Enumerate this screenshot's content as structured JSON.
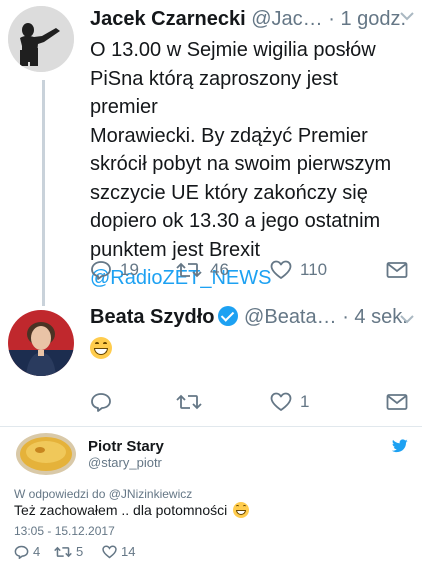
{
  "tweets": [
    {
      "name": "Jacek Czarnecki",
      "handle": "@Jac…",
      "time": "· 1 godz.",
      "lines": [
        "O 13.00 w Sejmie wigilia posłów",
        "PiSna którą zaproszony jest premier",
        "Morawiecki. By zdążyć Premier",
        "skrócił pobyt na swoim pierwszym",
        "szczycie UE który zakończy się",
        "dopiero ok 13.30 a jego ostatnim",
        "punktem jest Brexit"
      ],
      "mention": "@RadioZET_NEWS",
      "replies": "19",
      "retweets": "46",
      "likes": "110"
    },
    {
      "name": "Beata Szydło",
      "handle": "@Beata…",
      "time": "· 4 sek.",
      "replies": "",
      "retweets": "",
      "likes": "1"
    }
  ],
  "embed": {
    "name": "Piotr Stary",
    "handle": "@stary_piotr",
    "reply_to": "W odpowiedzi do @JNizinkiewicz",
    "text": "Też zachowałem .. dla potomności",
    "timestamp": "13:05 - 15.12.2017",
    "replies": "4",
    "retweets": "5",
    "likes": "14"
  },
  "colors": {
    "accent": "#1da1f2",
    "muted": "#657786",
    "text": "#14171a"
  },
  "icons": {
    "reply": "reply-icon",
    "retweet": "retweet-icon",
    "like": "heart-icon",
    "dm": "envelope-icon",
    "caret": "chevron-down-icon",
    "verified": "verified-badge-icon",
    "emoji": "grinning-face-emoji",
    "bird": "twitter-bird-icon"
  }
}
